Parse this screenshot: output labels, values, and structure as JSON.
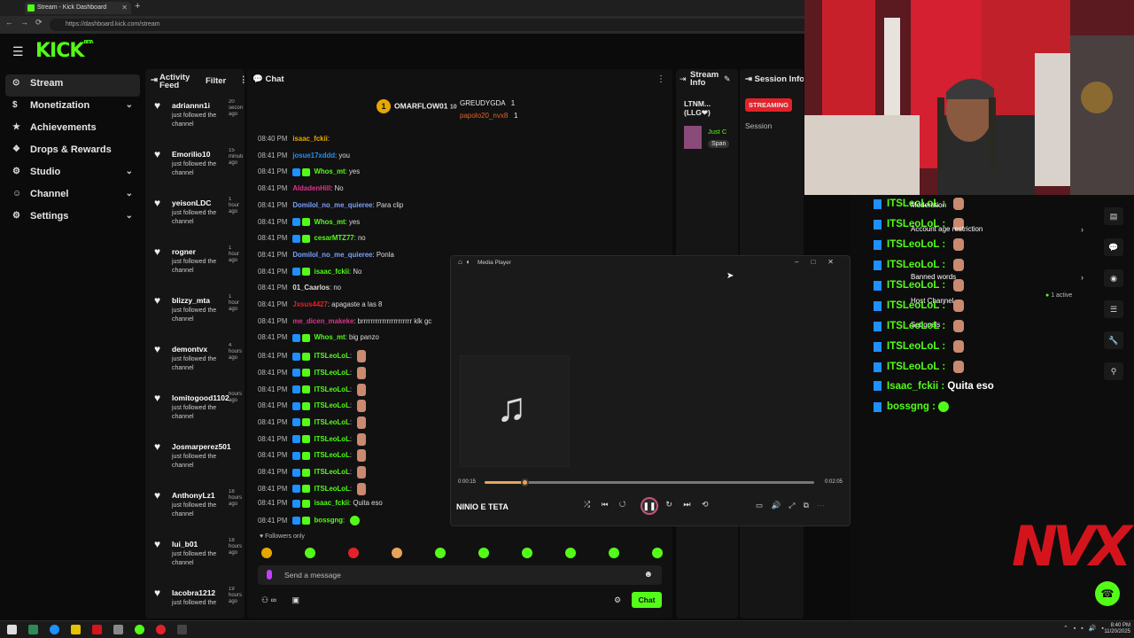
{
  "browser": {
    "tab_title": "Stream - Kick Dashboard",
    "url": "https://dashboard.kick.com/stream"
  },
  "brand": {
    "logo": "KICK",
    "logo_tag": "BETA",
    "accent": "#53fc18"
  },
  "sidebar": {
    "items": [
      {
        "label": "Stream",
        "icon": "broadcast-icon",
        "active": true
      },
      {
        "label": "Monetization",
        "icon": "dollar-icon",
        "chevron": true
      },
      {
        "label": "Achievements",
        "icon": "star-icon"
      },
      {
        "label": "Drops & Rewards",
        "icon": "gift-icon"
      },
      {
        "label": "Studio",
        "icon": "camera-icon",
        "chevron": true
      },
      {
        "label": "Channel",
        "icon": "user-icon",
        "chevron": true
      },
      {
        "label": "Settings",
        "icon": "gear-icon",
        "chevron": true
      }
    ]
  },
  "activity_feed": {
    "title": "Activity Feed",
    "filter_label": "Filter",
    "items": [
      {
        "name": "adriannn1i",
        "time": "20 seconds ago",
        "msg": "just followed the channel"
      },
      {
        "name": "Emorilio10",
        "time": "15 minutes ago",
        "msg": "just followed the channel"
      },
      {
        "name": "yeisonLDC",
        "time": "1 hour ago",
        "msg": "just followed the channel"
      },
      {
        "name": "rogner",
        "time": "1 hour ago",
        "msg": "just followed the channel"
      },
      {
        "name": "blizzy_mta",
        "time": "1 hour ago",
        "msg": "just followed the channel"
      },
      {
        "name": "demontvx",
        "time": "4 hours ago",
        "msg": "just followed the channel"
      },
      {
        "name": "lomitogood1102",
        "time": "hours ago",
        "msg": "just followed the channel"
      },
      {
        "name": "Josmarperez501",
        "time": "",
        "msg": "just followed the channel"
      },
      {
        "name": "AnthonyLz1",
        "time": "18 hours ago",
        "msg": "just followed the channel"
      },
      {
        "name": "lui_b01",
        "time": "18 hours ago",
        "msg": "just followed the channel"
      },
      {
        "name": "lacobra1212",
        "time": "19 hours ago",
        "msg": "just followed the"
      }
    ]
  },
  "chat": {
    "title": "Chat",
    "pinned": {
      "top_gifter_rank": "1",
      "top_gifter": "OMARFLOW01",
      "top_gifter_count": "10",
      "second": "GREUDYGDA",
      "second_count": "1",
      "third": "papolo20_nvx8",
      "third_count": "1"
    },
    "messages": [
      {
        "time": "08:40 PM",
        "user": "isaac_fckii",
        "text": "",
        "color": "#e6a800"
      },
      {
        "time": "08:41 PM",
        "user": "josue17xddd",
        "text": "you",
        "color": "#1e90ff"
      },
      {
        "time": "08:41 PM",
        "user": "Whos_mt",
        "text": "yes",
        "color": "#53fc18"
      },
      {
        "time": "08:41 PM",
        "user": "AldadenHill",
        "text": "No",
        "color": "#e0338a"
      },
      {
        "time": "08:41 PM",
        "user": "Domilol_no_me_quieree",
        "text": "Para clip",
        "color": "#7aa0ff"
      },
      {
        "time": "08:41 PM",
        "user": "Whos_mt",
        "text": "yes",
        "color": "#53fc18"
      },
      {
        "time": "08:41 PM",
        "user": "cesarMTZ77",
        "text": "no",
        "color": "#53fc18"
      },
      {
        "time": "08:41 PM",
        "user": "Domilol_no_me_quieree",
        "text": "Ponla",
        "color": "#7aa0ff"
      },
      {
        "time": "08:41 PM",
        "user": "isaac_fckii",
        "text": "No",
        "color": "#53fc18"
      },
      {
        "time": "08:41 PM",
        "user": "01_Caarlos",
        "text": "no",
        "color": "#dddddd"
      },
      {
        "time": "08:41 PM",
        "user": "Jxsus4427",
        "text": "apagaste a las 8",
        "color": "#e2222a"
      },
      {
        "time": "08:41 PM",
        "user": "me_dicen_makeke",
        "text": "brrrrrrrrrrrrrrrrrrrrrr klk gc",
        "color": "#e0338a"
      },
      {
        "time": "08:41 PM",
        "user": "Whos_mt",
        "text": "big panzo",
        "color": "#53fc18"
      },
      {
        "time": "08:41 PM",
        "user": "ITSLeoLoL",
        "text": "",
        "color": "#53fc18"
      },
      {
        "time": "08:41 PM",
        "user": "ITSLeoLoL",
        "text": "",
        "color": "#53fc18"
      },
      {
        "time": "08:41 PM",
        "user": "ITSLeoLoL",
        "text": "",
        "color": "#53fc18"
      },
      {
        "time": "08:41 PM",
        "user": "ITSLeoLoL",
        "text": "",
        "color": "#53fc18"
      },
      {
        "time": "08:41 PM",
        "user": "ITSLeoLoL",
        "text": "",
        "color": "#53fc18"
      },
      {
        "time": "08:41 PM",
        "user": "ITSLeoLoL",
        "text": "",
        "color": "#53fc18"
      },
      {
        "time": "08:41 PM",
        "user": "ITSLeoLoL",
        "text": "",
        "color": "#53fc18"
      },
      {
        "time": "08:41 PM",
        "user": "ITSLeoLoL",
        "text": "",
        "color": "#53fc18"
      },
      {
        "time": "08:41 PM",
        "user": "ITSLeoLoL",
        "text": "",
        "color": "#53fc18"
      },
      {
        "time": "08:41 PM",
        "user": "isaac_fckii",
        "text": "Quita eso",
        "color": "#53fc18"
      },
      {
        "time": "08:41 PM",
        "user": "bossgng",
        "text": "",
        "color": "#53fc18"
      }
    ],
    "followers_only": "Followers only",
    "input_placeholder": "Send a message",
    "send_label": "Chat"
  },
  "stream_info": {
    "title": "Stream Info",
    "stream_name": "LTNM... (LLG❤)",
    "category": "Just C",
    "tag": "Span"
  },
  "session_info": {
    "title": "Session Info",
    "status": "STREAMING",
    "label": "Session"
  },
  "overlay_chat": {
    "messages": [
      {
        "user": "ITSLeoLoL",
        "text": "",
        "mod": "Moderation"
      },
      {
        "user": "ITSLeoLoL",
        "text": "",
        "mod": "Account age restriction"
      },
      {
        "user": "ITSLeoLoL",
        "text": "",
        "mod": ""
      },
      {
        "user": "ITSLeoLoL",
        "text": "",
        "mod": "Banned words"
      },
      {
        "user": "ITSLeoLoL",
        "text": "",
        "mod": "Host Channel"
      },
      {
        "user": "ITSLeoLoL",
        "text": "",
        "mod": "Set goals"
      },
      {
        "user": "ITSLeoLoL",
        "text": "",
        "mod": ""
      },
      {
        "user": "ITSLeoLoL",
        "text": "",
        "mod": ""
      },
      {
        "user": "ITSLeoLoL",
        "text": "",
        "mod": ""
      },
      {
        "user": "Isaac_fckii",
        "text": "Quita eso",
        "mod": ""
      },
      {
        "user": "bossgng",
        "text": "",
        "mod": ""
      }
    ],
    "active_count": "1 active"
  },
  "overlay_logo": "NVX",
  "media_player": {
    "title": "Media Player",
    "song": "NINIO E TETA",
    "current_time": "0:00:15",
    "duration": "0:02:05",
    "progress": 0.12
  },
  "taskbar": {
    "time": "8:40 PM",
    "date": "11/20/2025"
  }
}
